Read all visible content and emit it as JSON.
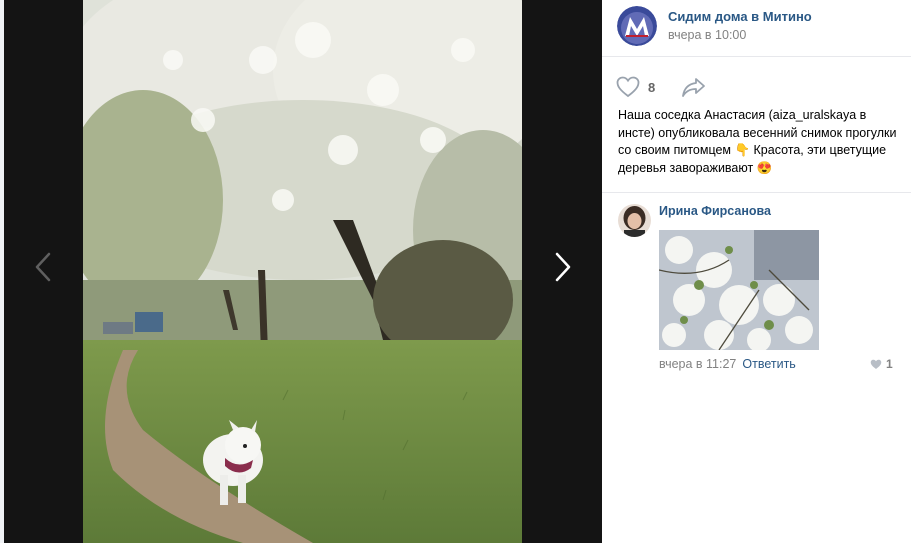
{
  "post": {
    "group_name": "Сидим дома в Митино",
    "time": "вчера в 10:00",
    "likes": "8",
    "text": "Наша соседка Анастасия (aiza_uralskaya в инсте) опубликовала весенний снимок прогулки со своим питомцем 👇 Красота, эти цветущие деревья завораживают 😍"
  },
  "comment": {
    "author": "Ирина Фирсанова",
    "time": "вчера в 11:27",
    "reply_label": "Ответить",
    "likes": "1"
  },
  "icons": {
    "prev": "chevron-left-icon",
    "next": "chevron-right-icon",
    "like": "heart-icon",
    "share": "share-arrow-icon",
    "comment_like": "heart-icon"
  },
  "colors": {
    "link": "#2a5885",
    "muted": "#828282",
    "viewer_bg": "#141414",
    "avatar_bg": "#3a4a9a",
    "avatar_letter": "#c02030"
  }
}
